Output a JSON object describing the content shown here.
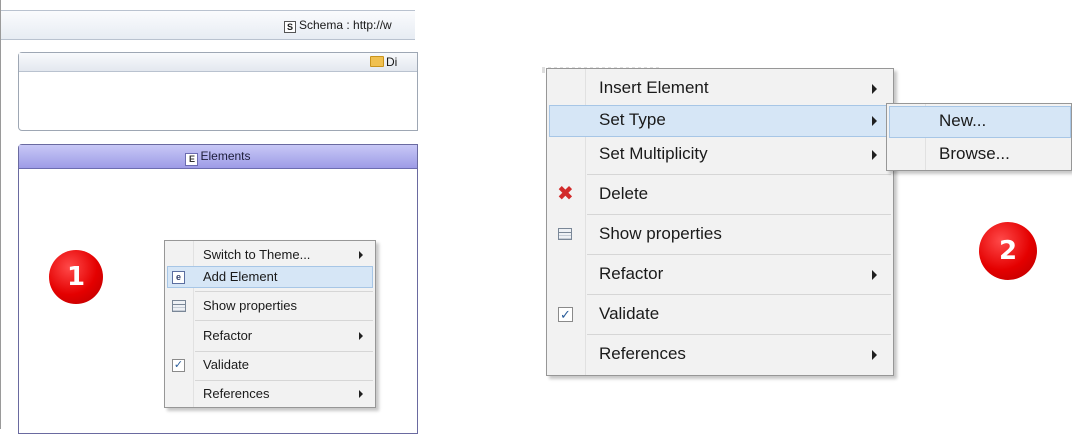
{
  "editor": {
    "schema_label": "Schema : http://w",
    "directives_label": "Di",
    "elements_label": "Elements"
  },
  "menu_small": {
    "items": [
      {
        "label": "Switch to Theme..."
      },
      {
        "label": "Add Element"
      },
      {
        "label": "Show properties"
      },
      {
        "label": "Refactor"
      },
      {
        "label": "Validate"
      },
      {
        "label": "References"
      }
    ]
  },
  "menu_large": {
    "items": [
      {
        "label": "Insert Element"
      },
      {
        "label": "Set Type"
      },
      {
        "label": "Set Multiplicity"
      },
      {
        "label": "Delete"
      },
      {
        "label": "Show properties"
      },
      {
        "label": "Refactor"
      },
      {
        "label": "Validate"
      },
      {
        "label": "References"
      }
    ]
  },
  "submenu_set_type": {
    "items": [
      {
        "label": "New..."
      },
      {
        "label": "Browse..."
      }
    ]
  },
  "badges": {
    "step1": "1",
    "step2": "2"
  },
  "icons": {
    "schema": "schema-icon",
    "directives": "folder-icon",
    "elements": "element-icon",
    "add_element": "element-icon",
    "show_properties": "properties-icon",
    "validate": "checkbox-icon",
    "delete": "delete-x-icon"
  },
  "colors": {
    "selection": "#d6e6f6",
    "elements_header": "#a9a7ec",
    "badge": "#e40000",
    "delete_icon": "#d22b2b"
  }
}
